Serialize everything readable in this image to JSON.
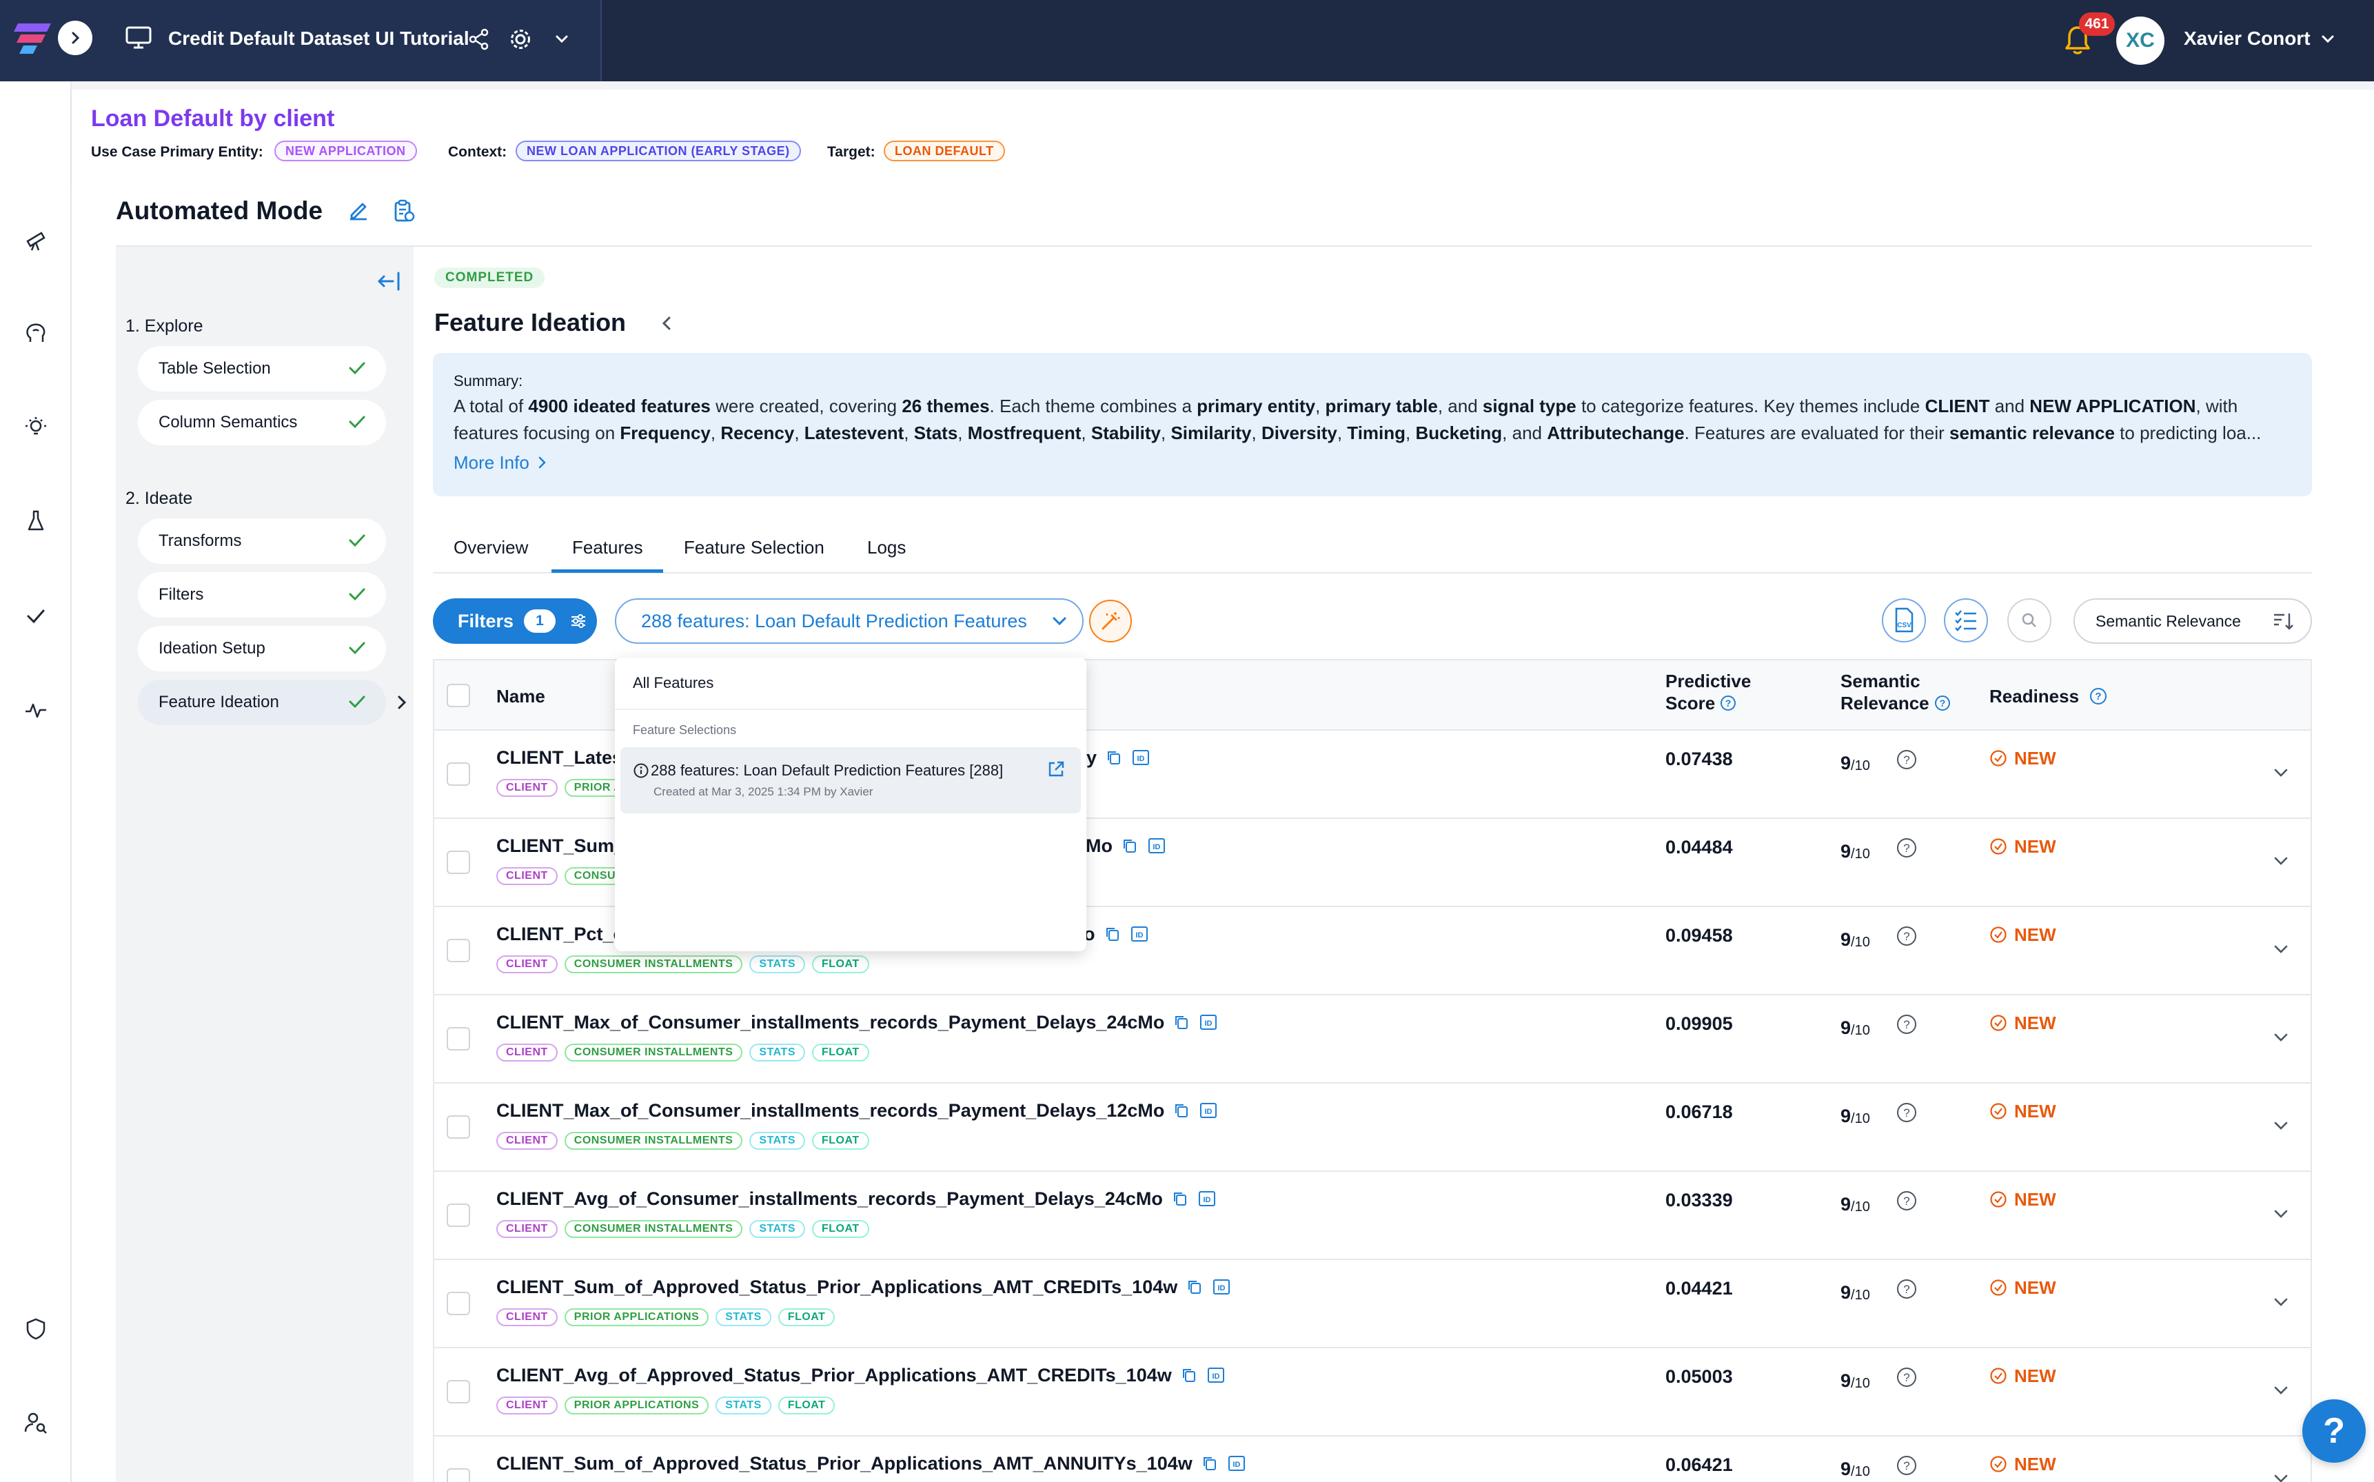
{
  "topbar": {
    "title": "Credit Default Dataset UI Tutorial",
    "notifications": "461",
    "avatar_initials": "XC",
    "user_name": "Xavier Conort"
  },
  "header": {
    "use_case_title": "Loan Default by client",
    "primary_entity_label": "Use Case Primary Entity:",
    "primary_entity": "NEW APPLICATION",
    "context_label": "Context:",
    "context": "NEW LOAN APPLICATION (EARLY STAGE)",
    "target_label": "Target:",
    "target": "LOAN DEFAULT"
  },
  "mode": {
    "title": "Automated Mode"
  },
  "steps": {
    "explore_heading": "1. Explore",
    "explore_items": [
      "Table Selection",
      "Column Semantics"
    ],
    "ideate_heading": "2. Ideate",
    "ideate_items": [
      "Transforms",
      "Filters",
      "Ideation Setup",
      "Feature Ideation"
    ]
  },
  "content": {
    "status": "COMPLETED",
    "title": "Feature Ideation",
    "summary_label": "Summary:",
    "summary_parts": {
      "p1": "A total of ",
      "b1": "4900 ideated features",
      "p2": " were created, covering ",
      "b2": "26 themes",
      "p3": ". Each theme combines a ",
      "b3": "primary entity",
      "p4": ", ",
      "b4": "primary table",
      "p5": ", and ",
      "b5": "signal type",
      "p6": " to categorize features. Key themes include ",
      "b6": "CLIENT",
      "p7": " and ",
      "b7": "NEW APPLICATION",
      "p8": ", with features focusing on ",
      "b8": "Frequency",
      "p9": ", ",
      "b9": "Recency",
      "p10": ", ",
      "b10": "Latestevent",
      "p11": ", ",
      "b11": "Stats",
      "p12": ", ",
      "b12": "Mostfrequent",
      "p13": ", ",
      "b13": "Stability",
      "p14": ", ",
      "b14": "Similarity",
      "p15": ", ",
      "b15": "Diversity",
      "p16": ", ",
      "b16": "Timing",
      "p17": ", ",
      "b17": "Bucketing",
      "p18": ", and ",
      "b18": "Attributechange",
      "p19": ". Features are evaluated for their ",
      "b19": "semantic relevance",
      "p20": " to predicting loa..."
    },
    "more_info": "More Info",
    "tabs": [
      "Overview",
      "Features",
      "Feature Selection",
      "Logs"
    ],
    "active_tab": "Features"
  },
  "toolbar": {
    "filters_label": "Filters",
    "filters_count": "1",
    "selection_label": "288 features: Loan Default Prediction Features",
    "csv_label": "CSV",
    "sort_label": "Semantic Relevance"
  },
  "dropdown": {
    "all_features": "All Features",
    "section_label": "Feature Selections",
    "item_label": "288 features: Loan Default Prediction Features [288]",
    "item_sub": "Created at Mar 3, 2025 1:34 PM by Xavier"
  },
  "table": {
    "headers": {
      "name": "Name",
      "predictive_score_1": "Predictive",
      "predictive_score_2": "Score",
      "semantic_relevance_1": "Semantic",
      "semantic_relevance_2": "Relevance",
      "readiness": "Readiness"
    },
    "rows": [
      {
        "name_visible": "CLIENT_Lates",
        "name_tail": "y",
        "tags": [
          "CLIENT",
          "PRIOR A"
        ],
        "score": "0.07438",
        "relevance": "9",
        "relevance_den": "/10",
        "readiness": "NEW"
      },
      {
        "name_visible": "CLIENT_Sum_",
        "name_tail": "cMo",
        "tags": [
          "CLIENT",
          "CONSU"
        ],
        "score": "0.04484",
        "relevance": "9",
        "relevance_den": "/10",
        "readiness": "NEW"
      },
      {
        "name_visible": "CLIENT_Pct_o",
        "name_tail": "o",
        "tags": [
          "CLIENT",
          "CONSUMER INSTALLMENTS",
          "STATS",
          "FLOAT"
        ],
        "score": "0.09458",
        "relevance": "9",
        "relevance_den": "/10",
        "readiness": "NEW"
      },
      {
        "name_visible": "CLIENT_Max_of_Consumer_installments_records_Payment_Delays_24cMo",
        "name_tail": "",
        "tags": [
          "CLIENT",
          "CONSUMER INSTALLMENTS",
          "STATS",
          "FLOAT"
        ],
        "score": "0.09905",
        "relevance": "9",
        "relevance_den": "/10",
        "readiness": "NEW"
      },
      {
        "name_visible": "CLIENT_Max_of_Consumer_installments_records_Payment_Delays_12cMo",
        "name_tail": "",
        "tags": [
          "CLIENT",
          "CONSUMER INSTALLMENTS",
          "STATS",
          "FLOAT"
        ],
        "score": "0.06718",
        "relevance": "9",
        "relevance_den": "/10",
        "readiness": "NEW"
      },
      {
        "name_visible": "CLIENT_Avg_of_Consumer_installments_records_Payment_Delays_24cMo",
        "name_tail": "",
        "tags": [
          "CLIENT",
          "CONSUMER INSTALLMENTS",
          "STATS",
          "FLOAT"
        ],
        "score": "0.03339",
        "relevance": "9",
        "relevance_den": "/10",
        "readiness": "NEW"
      },
      {
        "name_visible": "CLIENT_Sum_of_Approved_Status_Prior_Applications_AMT_CREDITs_104w",
        "name_tail": "",
        "tags": [
          "CLIENT",
          "PRIOR APPLICATIONS",
          "STATS",
          "FLOAT"
        ],
        "score": "0.04421",
        "relevance": "9",
        "relevance_den": "/10",
        "readiness": "NEW"
      },
      {
        "name_visible": "CLIENT_Avg_of_Approved_Status_Prior_Applications_AMT_CREDITs_104w",
        "name_tail": "",
        "tags": [
          "CLIENT",
          "PRIOR APPLICATIONS",
          "STATS",
          "FLOAT"
        ],
        "score": "0.05003",
        "relevance": "9",
        "relevance_den": "/10",
        "readiness": "NEW"
      },
      {
        "name_visible": "CLIENT_Sum_of_Approved_Status_Prior_Applications_AMT_ANNUITYs_104w",
        "name_tail": "",
        "tags": [
          "CLIENT",
          "PRIOR APPLICATIONS",
          "STATS",
          "FLOAT"
        ],
        "score": "0.06421",
        "relevance": "9",
        "relevance_den": "/10",
        "readiness": "NEW"
      }
    ]
  },
  "help": {
    "label": "?"
  },
  "colors": {
    "accent": "#1c7ed6",
    "topbar": "#1e2a44",
    "purple_title": "#7c3aed",
    "new_orange": "#e8590c",
    "check_green": "#2f9e44"
  }
}
